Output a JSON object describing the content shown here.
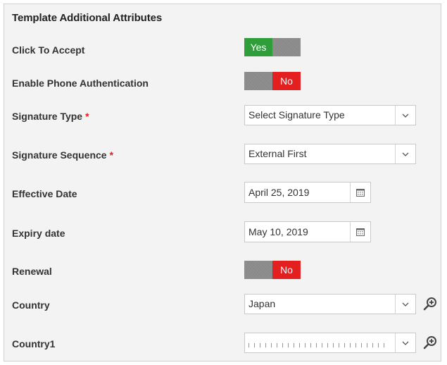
{
  "title": "Template Additional Attributes",
  "colors": {
    "yes": "#2f9d3a",
    "no": "#e41f1f",
    "toggle_off": "#8a8a8a",
    "required": "#e02020"
  },
  "fields": {
    "click_to_accept": {
      "label": "Click To Accept",
      "toggle_text": "Yes",
      "state": "on"
    },
    "phone_auth": {
      "label": "Enable Phone Authentication",
      "toggle_text": "No",
      "state": "off"
    },
    "signature_type": {
      "label": "Signature Type",
      "required_mark": "*",
      "value": "Select Signature Type",
      "icon": "chevron-down-icon"
    },
    "signature_sequence": {
      "label": "Signature Sequence",
      "required_mark": "*",
      "value": "External First",
      "icon": "chevron-down-icon"
    },
    "effective_date": {
      "label": "Effective Date",
      "value": "April 25, 2019",
      "icon": "calendar-icon"
    },
    "expiry_date": {
      "label": "Expiry date",
      "value": "May 10, 2019",
      "icon": "calendar-icon"
    },
    "renewal": {
      "label": "Renewal",
      "toggle_text": "No",
      "state": "off"
    },
    "country": {
      "label": "Country",
      "value": "Japan",
      "icon": "chevron-down-icon",
      "lookup_icon": "search-plus-icon"
    },
    "country1": {
      "label": "Country1",
      "value": "",
      "icon": "chevron-down-icon",
      "lookup_icon": "search-plus-icon"
    }
  }
}
